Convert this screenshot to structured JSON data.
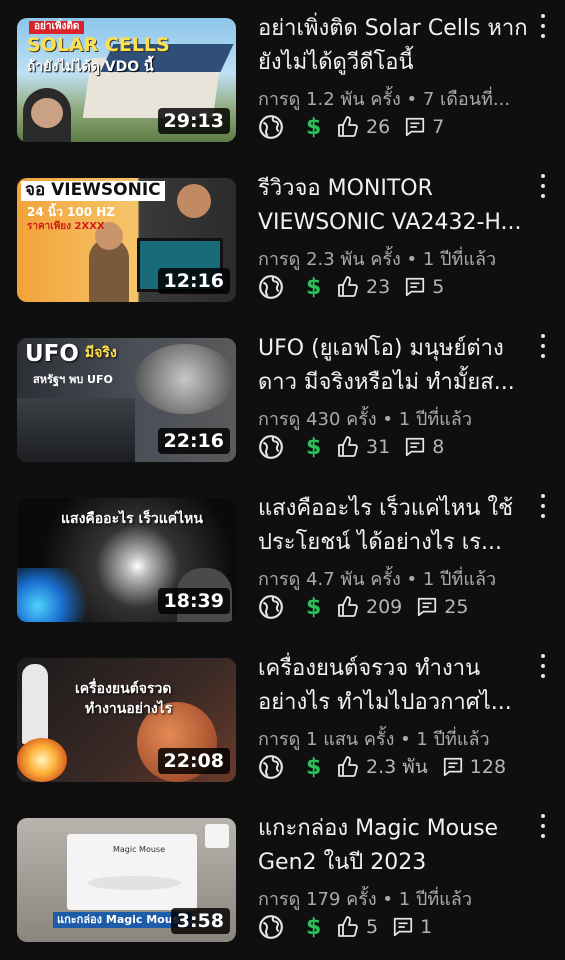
{
  "videos": [
    {
      "thumb_lines": [
        "อย่าเพิ่งติด",
        "SOLAR CELLS",
        "ถ้ายังไม่ได้ดู VDO นี้"
      ],
      "duration": "29:13",
      "title": "อย่าเพิ่งติด Solar Cells หากยังไม่ได้ดูวีดีโอนี้",
      "meta": "การดู 1.2 พัน ครั้ง • 7 เดือนที่...",
      "likes": "26",
      "comments": "7"
    },
    {
      "thumb_lines": [
        "จอ VIEWSONIC",
        "24 นิ้ว 100 HZ",
        "ราคาเพียง 2XXX"
      ],
      "duration": "12:16",
      "title": "รีวิวจอ MONITOR VIEWSONIC VA2432-H...",
      "meta": "การดู 2.3 พัน ครั้ง • 1 ปีที่แล้ว",
      "likes": "23",
      "comments": "5"
    },
    {
      "thumb_lines": [
        "UFO",
        "มีจริง",
        "สหรัฐฯ พบ UFO"
      ],
      "duration": "22:16",
      "title": "UFO (ยูเอฟโอ) มนุษย์ต่างดาว มีจริงหรือไม่ ทำมั้ยส...",
      "meta": "การดู 430 ครั้ง • 1 ปีที่แล้ว",
      "likes": "31",
      "comments": "8"
    },
    {
      "thumb_lines": [
        "แสงคืออะไร เร็วแค่ไหน"
      ],
      "duration": "18:39",
      "title": "แสงคืออะไร เร็วแค่ไหน ใช้ประโยชน์ ได้อย่างไร เร...",
      "meta": "การดู 4.7 พัน ครั้ง • 1 ปีที่แล้ว",
      "likes": "209",
      "comments": "25"
    },
    {
      "thumb_lines": [
        "เครื่องยนต์จรวด",
        "ทำงานอย่างไร"
      ],
      "duration": "22:08",
      "title": "เครื่องยนต์จรวจ ทำงาน อย่างไร ทำไมไปอวกาศไ...",
      "meta": "การดู 1 แสน ครั้ง • 1 ปีที่แล้ว",
      "likes": "2.3 พัน",
      "comments": "128"
    },
    {
      "thumb_lines": [
        "Magic Mouse",
        "แกะกล่อง Magic Mouse"
      ],
      "duration": "3:58",
      "title": "แกะกล่อง Magic Mouse Gen2 ในปี 2023",
      "meta": "การดู 179 ครั้ง • 1 ปีที่แล้ว",
      "likes": "5",
      "comments": "1"
    }
  ],
  "colors": {
    "background": "#0f0f0f",
    "monetized": "#2fbf5a",
    "meta_text": "#aaaaaa"
  },
  "icons": [
    "globe-icon",
    "dollar-icon",
    "like-icon",
    "comment-icon",
    "more-vert-icon"
  ]
}
